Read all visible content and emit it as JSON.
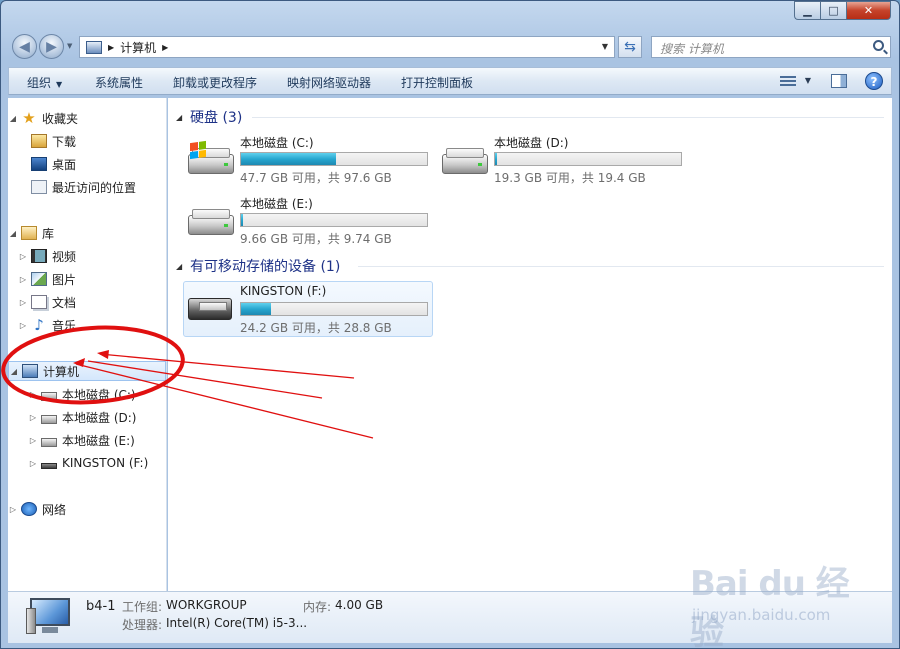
{
  "window": {
    "caption_min": "▁",
    "caption_max": "□",
    "caption_close": "✕"
  },
  "address_bar": {
    "path": "计算机",
    "search_placeholder": "搜索 计算机"
  },
  "toolbar": {
    "organize": "组织",
    "system_properties": "系统属性",
    "uninstall": "卸载或更改程序",
    "map_drive": "映射网络驱动器",
    "control_panel": "打开控制面板",
    "help": "?"
  },
  "nav_pane": {
    "favorites": "收藏夹",
    "downloads": "下载",
    "desktop": "桌面",
    "recent": "最近访问的位置",
    "libraries": "库",
    "videos": "视频",
    "pictures": "图片",
    "documents": "文档",
    "music": "音乐",
    "computer": "计算机",
    "drive_c": "本地磁盘 (C:)",
    "drive_d": "本地磁盘 (D:)",
    "drive_e": "本地磁盘 (E:)",
    "drive_f": "KINGSTON (F:)",
    "network": "网络"
  },
  "content": {
    "hdd_group": "硬盘 (3)",
    "removable_group": "有可移动存储的设备 (1)",
    "drives": [
      {
        "name": "本地磁盘 (C:)",
        "free": "47.7 GB 可用，共 97.6 GB",
        "used_fraction": 0.51
      },
      {
        "name": "本地磁盘 (D:)",
        "free": "19.3 GB 可用，共 19.4 GB",
        "used_fraction": 0.005
      },
      {
        "name": "本地磁盘 (E:)",
        "free": "9.66 GB 可用，共 9.74 GB",
        "used_fraction": 0.008
      },
      {
        "name": "KINGSTON (F:)",
        "free": "24.2 GB 可用，共 28.8 GB",
        "used_fraction": 0.16
      }
    ],
    "win_flag_colors": [
      "#f25022",
      "#7fba00",
      "#00a4ef",
      "#ffb900"
    ],
    "bar_fill_color": "#27a7d0"
  },
  "details": {
    "computer_name": "b4-1",
    "workgroup_label": "工作组:",
    "workgroup_value": "WORKGROUP",
    "memory_label": "内存:",
    "memory_value": "4.00 GB",
    "cpu_label": "处理器:",
    "cpu_value": "Intel(R) Core(TM) i5-3..."
  },
  "watermark": {
    "brand": "Bai du 经验",
    "url": "jingyan.baidu.com"
  },
  "annotation_color": "#e01010"
}
